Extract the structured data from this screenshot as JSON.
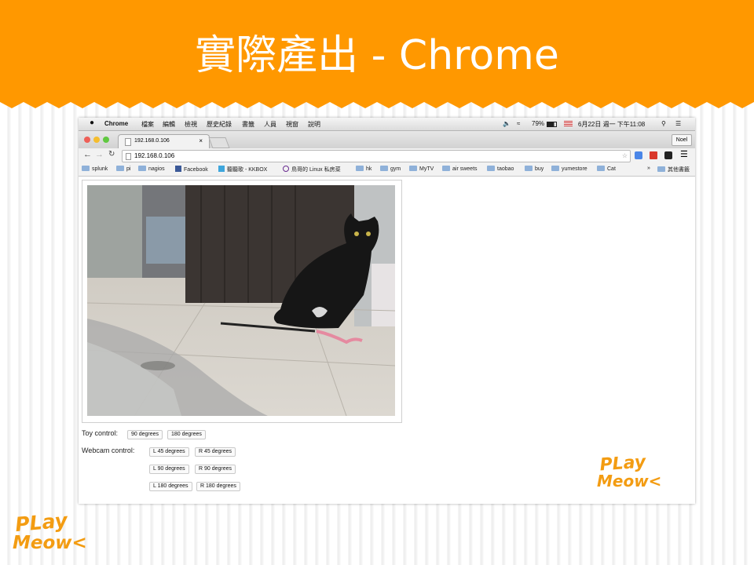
{
  "slide": {
    "title": "實際產出 - Chrome",
    "header_color": "#ff9800"
  },
  "macos_menubar": {
    "apple_icon": "apple-icon",
    "app": "Chrome",
    "menus": [
      "檔案",
      "編輯",
      "檢視",
      "歷史紀錄",
      "書籤",
      "人員",
      "視窗",
      "說明"
    ],
    "battery": "79%",
    "datetime": "6月22日 週一 下午11:08"
  },
  "browser": {
    "tab_title": "192.168.0.106",
    "profile": "Noel",
    "address": "192.168.0.106",
    "bookmarks": [
      "splunk",
      "pi",
      "nagios",
      "Facebook",
      "聽聽歌 - KKBOX",
      "鳥哥的 Linux 私房菜",
      "hk",
      "gym",
      "MyTV",
      "air sweets",
      "taobao",
      "buy",
      "yumestore",
      "Cat"
    ],
    "other_bookmarks": "其他書籤",
    "overflow": "»"
  },
  "page": {
    "toy_control": {
      "label": "Toy control:",
      "buttons": [
        "90 degrees",
        "180 degrees"
      ]
    },
    "webcam_control": {
      "label": "Webcam control:",
      "buttons": [
        "L 45 degrees",
        "R 45 degrees",
        "L 90 degrees",
        "R 90 degrees",
        "L 180 degrees",
        "R 180 degrees"
      ]
    }
  },
  "logo": {
    "line1": "PLay",
    "line2": "Meow<",
    "color": "#f39c12"
  }
}
